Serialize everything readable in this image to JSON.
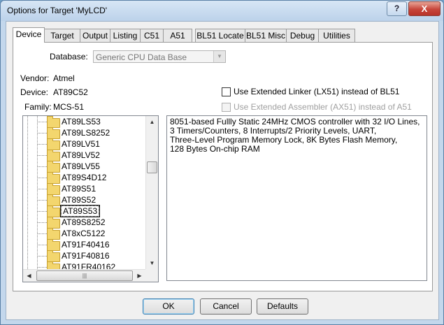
{
  "window": {
    "title": "Options for Target 'MyLCD'",
    "help_label": "?",
    "close_label": "X"
  },
  "tabs": [
    {
      "label": "Device"
    },
    {
      "label": "Target"
    },
    {
      "label": "Output"
    },
    {
      "label": "Listing"
    },
    {
      "label": "C51"
    },
    {
      "label": "A51"
    },
    {
      "label": "BL51 Locate"
    },
    {
      "label": "BL51 Misc"
    },
    {
      "label": "Debug"
    },
    {
      "label": "Utilities"
    }
  ],
  "database": {
    "label": "Database:",
    "value": "Generic CPU Data Base"
  },
  "info": {
    "vendor_label": "Vendor:",
    "vendor_value": "Atmel",
    "device_label": "Device:",
    "device_value": "AT89C52",
    "family_label": "Family:",
    "family_value": "MCS-51"
  },
  "options": {
    "linker_label": "Use Extended Linker (LX51) instead of BL51",
    "assembler_label": "Use Extended Assembler (AX51) instead of A51"
  },
  "tree": {
    "items": [
      {
        "label": "AT89LS53"
      },
      {
        "label": "AT89LS8252"
      },
      {
        "label": "AT89LV51"
      },
      {
        "label": "AT89LV52"
      },
      {
        "label": "AT89LV55"
      },
      {
        "label": "AT89S4D12"
      },
      {
        "label": "AT89S51"
      },
      {
        "label": "AT89S52"
      },
      {
        "label": "AT89S53"
      },
      {
        "label": "AT89S8252"
      },
      {
        "label": "AT8xC5122"
      },
      {
        "label": "AT91F40416"
      },
      {
        "label": "AT91F40816"
      },
      {
        "label": "AT91FR40162"
      }
    ],
    "selected": "AT89S53"
  },
  "description": {
    "lines": [
      "8051-based Fullly Static 24MHz CMOS controller with 32  I/O Lines,",
      "3 Timers/Counters, 8 Interrupts/2 Priority Levels, UART,",
      "Three-Level Program Memory Lock, 8K Bytes Flash Memory,",
      "128 Bytes On-chip RAM"
    ]
  },
  "buttons": {
    "ok": "OK",
    "cancel": "Cancel",
    "defaults": "Defaults"
  },
  "icons": {
    "folder": "folder-icon",
    "scroll_up": "arrow-up-icon",
    "scroll_down": "arrow-down-icon",
    "scroll_left": "arrow-left-icon",
    "scroll_right": "arrow-right-icon"
  },
  "colors": {
    "title_bar": "#c3d7ec",
    "close_button": "#c7453a",
    "folder": "#f3d66e"
  }
}
